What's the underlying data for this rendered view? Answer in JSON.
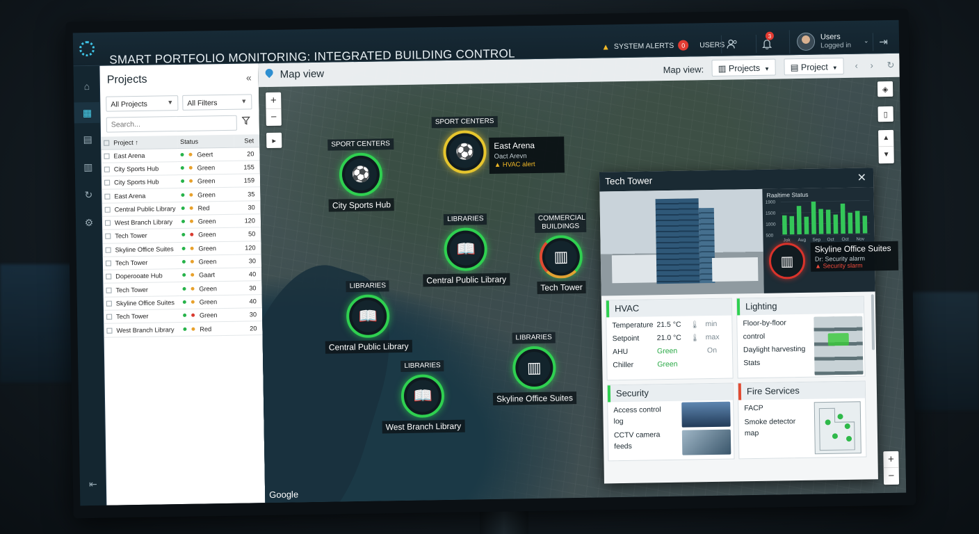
{
  "header": {
    "title": "SMART PORTFOLIO MONITORING: INTEGRATED BUILDING CONTROL",
    "system_alerts_label": "SYSTEM ALERTS",
    "system_alerts_count": "0",
    "users_label": "USERS",
    "notification_count": "3",
    "user_name": "Users",
    "user_status": "Logged in"
  },
  "sidebar": {
    "icons": [
      "home-icon",
      "dashboard-icon",
      "list-icon",
      "bar-chart-icon",
      "sync-icon",
      "settings-icon",
      "logout-icon"
    ]
  },
  "projects_panel": {
    "title": "Projects",
    "filter_projects": "All Projects",
    "filter_all": "All Filters",
    "search_placeholder": "Search...",
    "columns": [
      "Project ↑",
      "Status",
      "Set"
    ],
    "rows": [
      {
        "name": "East Arena",
        "status": "Geert",
        "val": "20",
        "c1": "#27b34a",
        "c2": "#e8a12c"
      },
      {
        "name": "City Sports Hub",
        "status": "Green",
        "val": "155",
        "c1": "#27b34a",
        "c2": "#e8a12c"
      },
      {
        "name": "City Sports Hub",
        "status": "Green",
        "val": "159",
        "c1": "#27b34a",
        "c2": "#e8a12c"
      },
      {
        "name": "East Arena",
        "status": "Green",
        "val": "35",
        "c1": "#27b34a",
        "c2": "#e8a12c"
      },
      {
        "name": "Central Public Library",
        "status": "Red",
        "val": "30",
        "c1": "#27b34a",
        "c2": "#e8a12c"
      },
      {
        "name": "West Branch Library",
        "status": "Green",
        "val": "120",
        "c1": "#27b34a",
        "c2": "#e8a12c"
      },
      {
        "name": "Tech Tower",
        "status": "Green",
        "val": "50",
        "c1": "#27b34a",
        "c2": "#d93b30"
      },
      {
        "name": "Skyline Office Suites",
        "status": "Green",
        "val": "120",
        "c1": "#27b34a",
        "c2": "#e8a12c"
      },
      {
        "name": "Tech Tower",
        "status": "Green",
        "val": "30",
        "c1": "#27b34a",
        "c2": "#e8a12c"
      },
      {
        "name": "Doperoоate Hub",
        "status": "Gaart",
        "val": "40",
        "c1": "#27b34a",
        "c2": "#e8a12c"
      },
      {
        "name": "Tech Tower",
        "status": "Green",
        "val": "30",
        "c1": "#27b34a",
        "c2": "#e8a12c"
      },
      {
        "name": "Skyline Office Suites",
        "status": "Green",
        "val": "40",
        "c1": "#27b34a",
        "c2": "#e8a12c"
      },
      {
        "name": "Tech Tower",
        "status": "Green",
        "val": "30",
        "c1": "#27b34a",
        "c2": "#d93b30"
      },
      {
        "name": "West Branch Library",
        "status": "Red",
        "val": "20",
        "c1": "#27b34a",
        "c2": "#e8a12c"
      }
    ]
  },
  "map": {
    "title": "Map view",
    "map_view_label": "Map view:",
    "projects_btn": "Projects",
    "project_btn": "Project",
    "google": "Google",
    "markers": [
      {
        "category": "SPORT CENTERS",
        "name": "City Sports Hub",
        "icon": "soccer-ball-icon"
      },
      {
        "category": "SPORT CENTERS",
        "name": "",
        "icon": "soccer-ball-icon"
      },
      {
        "category": "LIBRARIES",
        "name": "Central Public Library",
        "icon": "book-icon"
      },
      {
        "category": "LIBRARIES",
        "name": "Central Public Library",
        "icon": "book-icon"
      },
      {
        "category": "COMMERCIAL BUILDINGS",
        "name": "Tech Tower",
        "icon": "building-icon"
      },
      {
        "category": "LIBRARIES",
        "name": "West Branch Library",
        "icon": "book-icon"
      },
      {
        "category": "LIBRARIES",
        "name": "Skyline Office Suites",
        "icon": "building-icon"
      }
    ],
    "east_arena_tip": {
      "name": "East Arena",
      "sub": "Oact Arevn",
      "alert": "HVAC alert"
    }
  },
  "detail": {
    "title": "Tech Tower",
    "realtime_label": "Raaltime Status",
    "chart_data": {
      "type": "bar",
      "title": "Raaltime Status",
      "categories": [
        "Jok",
        "Aug",
        "Sep",
        "Oct",
        "Oct",
        "Nov"
      ],
      "series": [
        {
          "name": "",
          "values": [
            1150,
            1100,
            1700,
            1050,
            1950,
            1500,
            1450,
            1150,
            1800,
            1250,
            1350,
            1050
          ]
        }
      ],
      "ylabels": [
        "1900",
        "1500",
        "1000",
        "500"
      ],
      "ylim": [
        0,
        2000
      ]
    },
    "skyline": {
      "name": "Skyline Office Suites",
      "sub": "Dr: Security alarm",
      "alert": "Security slarm"
    },
    "hvac": {
      "title": "HVAC",
      "rows": [
        {
          "label": "Temperature",
          "value": "21.5 °C",
          "extra": "min"
        },
        {
          "label": "Setpoint",
          "value": "21.0 °C",
          "extra": "max"
        },
        {
          "label": "AHU",
          "value": "Green",
          "extra": "On"
        },
        {
          "label": "Chiller",
          "value": "Green",
          "extra": ""
        }
      ]
    },
    "lighting": {
      "title": "Lighting",
      "items": [
        "Floor-by-floor",
        "control",
        "Daylight harvesting",
        "Stats"
      ]
    },
    "security": {
      "title": "Security",
      "items": [
        "Access control",
        "log",
        "CCTV camera",
        "feeds"
      ]
    },
    "fire": {
      "title": "Fire Services",
      "items": [
        "FACP",
        "Smoke detector",
        "map"
      ]
    }
  }
}
